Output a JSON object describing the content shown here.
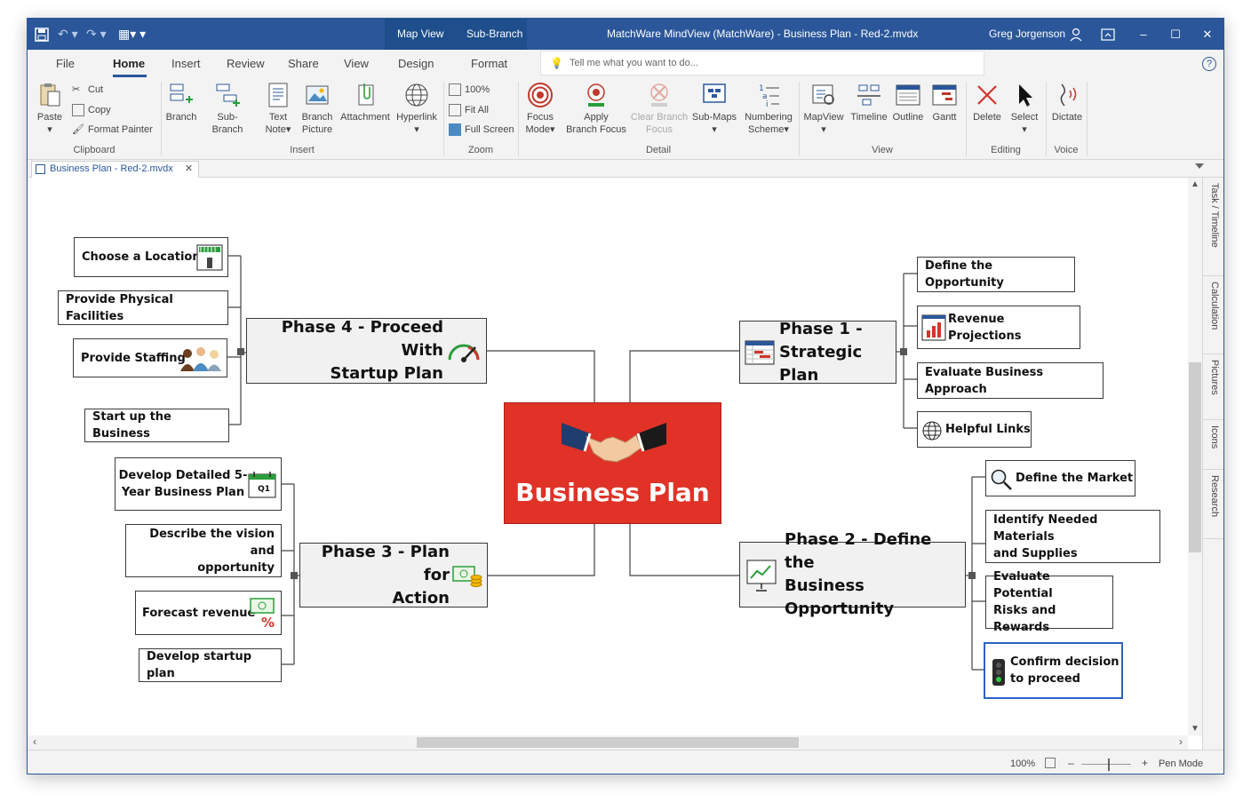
{
  "titlebar": {
    "context_tabs": [
      "Map View",
      "Sub-Branch"
    ],
    "title": "MatchWare MindView (MatchWare) - Business Plan - Red-2.mvdx",
    "user": "Greg Jorgenson",
    "minimize": "–",
    "maximize": "☐",
    "close": "✕"
  },
  "tabs": [
    "File",
    "Home",
    "Insert",
    "Review",
    "Share",
    "View",
    "Design",
    "Format"
  ],
  "tellme_placeholder": "Tell me what you want to do...",
  "ribbon": {
    "clipboard": {
      "paste": "Paste",
      "cut": "Cut",
      "copy": "Copy",
      "format_painter": "Format Painter",
      "label": "Clipboard"
    },
    "insert": {
      "branch": "Branch",
      "subbranch": "Sub-Branch",
      "text_note_1": "Text",
      "text_note_2": "Note",
      "branch_picture_1": "Branch",
      "branch_picture_2": "Picture",
      "attachment": "Attachment",
      "hyperlink": "Hyperlink",
      "label": "Insert"
    },
    "zoom": {
      "pct": "100%",
      "fit_all": "Fit All",
      "full_screen": "Full Screen",
      "label": "Zoom"
    },
    "detail": {
      "focus_mode_1": "Focus",
      "focus_mode_2": "Mode",
      "apply_branch_focus_1": "Apply",
      "apply_branch_focus_2": "Branch Focus",
      "clear_branch_focus_1": "Clear Branch",
      "clear_branch_focus_2": "Focus",
      "submaps": "Sub-Maps",
      "numbering_scheme_1": "Numbering",
      "numbering_scheme_2": "Scheme",
      "label": "Detail"
    },
    "view": {
      "mapview": "MapView",
      "timeline": "Timeline",
      "outline": "Outline",
      "gantt": "Gantt",
      "label": "View"
    },
    "editing": {
      "delete": "Delete",
      "select": "Select",
      "label": "Editing"
    },
    "voice": {
      "dictate": "Dictate",
      "label": "Voice"
    }
  },
  "document_tab": "Business Plan - Red-2.mvdx",
  "side_tabs": [
    "Task / Timeline",
    "Calculation",
    "Pictures",
    "Icons",
    "Research"
  ],
  "statusbar": {
    "zoom": "100%",
    "minus": "–",
    "plus": "+",
    "pen_mode": "Pen Mode"
  },
  "central": "Business Plan",
  "phases": {
    "p1_line1": "Phase 1 -",
    "p1_line2": "Strategic Plan",
    "p2_line1": "Phase 2 - Define the",
    "p2_line2": "Business Opportunity",
    "p3_line1": "Phase 3 - Plan for",
    "p3_line2": "Action",
    "p4_line1": "Phase 4 - Proceed With",
    "p4_line2": "Startup Plan"
  },
  "nodes": {
    "define_opportunity": "Define the Opportunity",
    "revenue_projections": "Revenue Projections",
    "evaluate_business_approach": "Evaluate Business Approach",
    "helpful_links": "Helpful Links",
    "define_market": "Define the Market",
    "identify_materials_1": "Identify Needed Materials",
    "identify_materials_2": "and Supplies",
    "evaluate_risks_1": "Evaluate Potential",
    "evaluate_risks_2": "Risks and Rewards",
    "confirm_decision_1": "Confirm decision",
    "confirm_decision_2": "to proceed",
    "develop_5yr_1": "Develop Detailed 5-",
    "develop_5yr_2": "Year Business Plan",
    "describe_vision_1": "Describe the vision and",
    "describe_vision_2": "opportunity",
    "forecast_revenue": "Forecast revenue",
    "develop_startup": "Develop startup plan",
    "choose_location": "Choose a Location",
    "physical_facilities": "Provide Physical Facilities",
    "provide_staffing": "Provide Staffing",
    "start_business": "Start up the Business"
  },
  "calendar_badge": "Q1",
  "colors": {
    "title_bar": "#2b579a",
    "central_topic": "#e03227",
    "ribbon_bg": "#f3f3f3",
    "selection": "#2b63c6"
  }
}
